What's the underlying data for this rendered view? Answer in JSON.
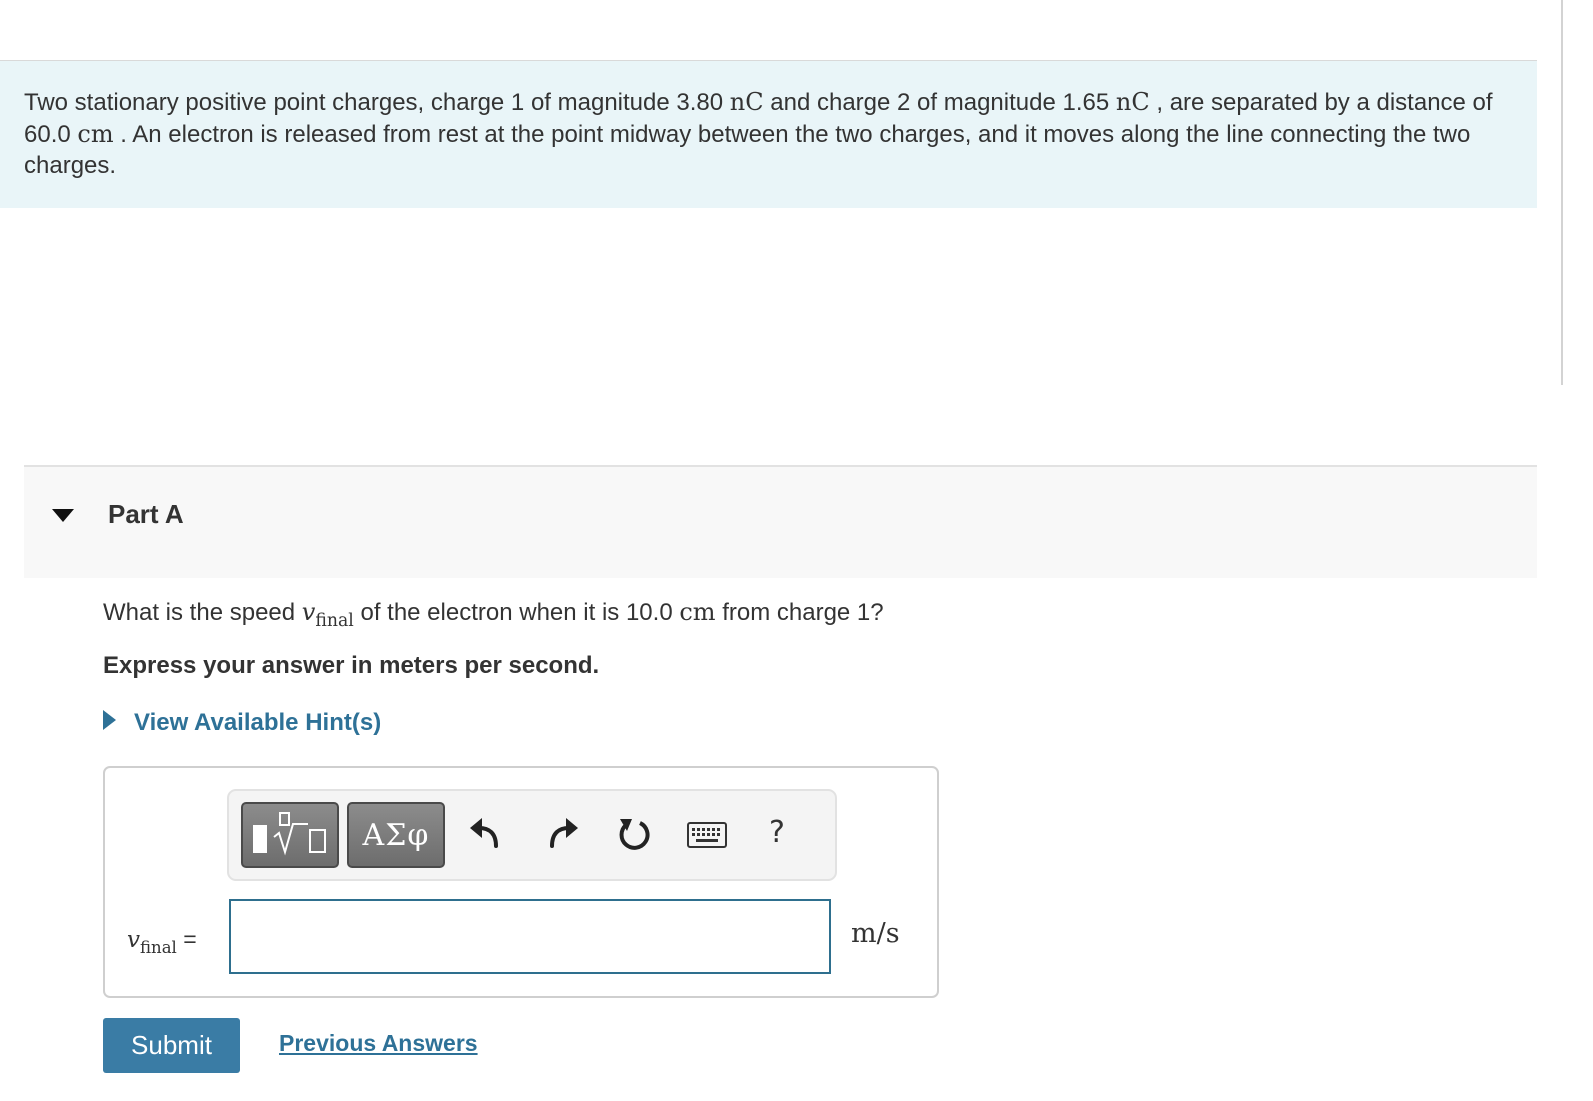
{
  "problem": {
    "intro_p1": "Two stationary positive point charges, charge 1 of magnitude ",
    "q1_value": "3.80",
    "q1_unit": "nC",
    "intro_p2": " and charge 2 of magnitude ",
    "q2_value": "1.65",
    "q2_unit": "nC",
    "intro_p3": " , are separated by a distance of ",
    "distance_value": "60.0",
    "distance_unit": "cm",
    "intro_p4": " . An electron is released from rest at the point midway between the two charges, and it moves along the line connecting the two charges."
  },
  "part": {
    "title": "Part A",
    "question_p1": "What is the speed ",
    "var_symbol": "v",
    "var_subscript": "final",
    "question_p2": " of the electron when it is ",
    "question_value": "10.0",
    "question_unit": "cm",
    "question_p3": " from charge 1?",
    "instruction": "Express your answer in meters per second.",
    "hint_link": "View Available Hint(s)"
  },
  "toolbar": {
    "greek_label": "ΑΣφ",
    "help_label": "?",
    "icons": [
      "templates-icon",
      "greek-symbols-icon",
      "undo-icon",
      "redo-icon",
      "reset-icon",
      "keyboard-icon",
      "help-icon"
    ]
  },
  "answer": {
    "var_symbol": "v",
    "var_subscript": "final",
    "equals": "=",
    "input_value": "",
    "unit": "m/s"
  },
  "actions": {
    "submit_label": "Submit",
    "previous_answers_label": "Previous Answers"
  },
  "colors": {
    "intro_background": "#e9f5f8",
    "link": "#2e7197",
    "submit_background": "#3a7ca5",
    "input_border": "#2e6f8e",
    "toolbar_button": "#7a7a7a"
  }
}
